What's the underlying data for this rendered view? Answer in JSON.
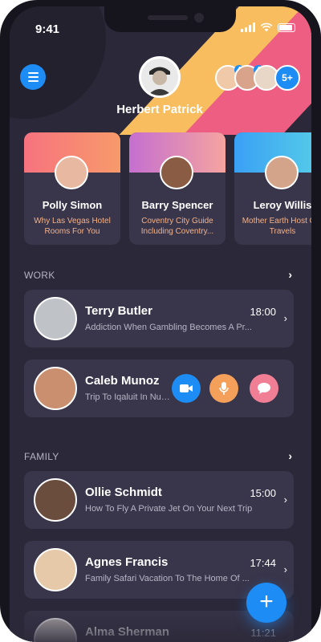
{
  "status_bar": {
    "time": "9:41"
  },
  "profile": {
    "name": "Herbert Patrick"
  },
  "group": {
    "badge1": "4",
    "badge2": "4",
    "more": "5+"
  },
  "stories": [
    {
      "name": "Polly Simon",
      "subtitle": "Why Las Vegas Hotel Rooms For You",
      "color_top": "#f7737f",
      "color_bottom": "#f79a6a"
    },
    {
      "name": "Barry Spencer",
      "subtitle": "Coventry City Guide Including Coventry...",
      "color_top": "#c56fd0",
      "color_bottom": "#f5a4a0"
    },
    {
      "name": "Leroy Willis",
      "subtitle": "Mother Earth Host Our Travels",
      "color_top": "#3aa0f5",
      "color_bottom": "#59d2e6"
    }
  ],
  "sections": {
    "work": "WORK",
    "family": "FAMILY"
  },
  "work_chats": [
    {
      "name": "Terry Butler",
      "time": "18:00",
      "message": "Addiction When Gambling Becomes A Pr..."
    },
    {
      "name": "Caleb Munoz",
      "time": "",
      "message": "Trip To Iqaluit In Nunavut A Ca..."
    }
  ],
  "family_chats": [
    {
      "name": "Ollie Schmidt",
      "time": "15:00",
      "message": "How To Fly A Private Jet On Your Next Trip"
    },
    {
      "name": "Agnes Francis",
      "time": "17:44",
      "message": "Family Safari Vacation To The Home Of ..."
    },
    {
      "name": "Alma Sherman",
      "time": "11:21",
      "message": ""
    }
  ],
  "colors": {
    "accent": "#1e8cf5",
    "yellow": "#f7bd5f",
    "pink": "#ee5d82",
    "video": "#1e8cf5",
    "mic": "#f5a05a",
    "chat": "#f07f95",
    "card": "#39354a",
    "background": "#2b2839"
  },
  "icons": [
    "hamburger-menu-icon",
    "video-camera-icon",
    "microphone-icon",
    "chat-bubble-icon",
    "chevron-right-icon",
    "plus-icon"
  ]
}
